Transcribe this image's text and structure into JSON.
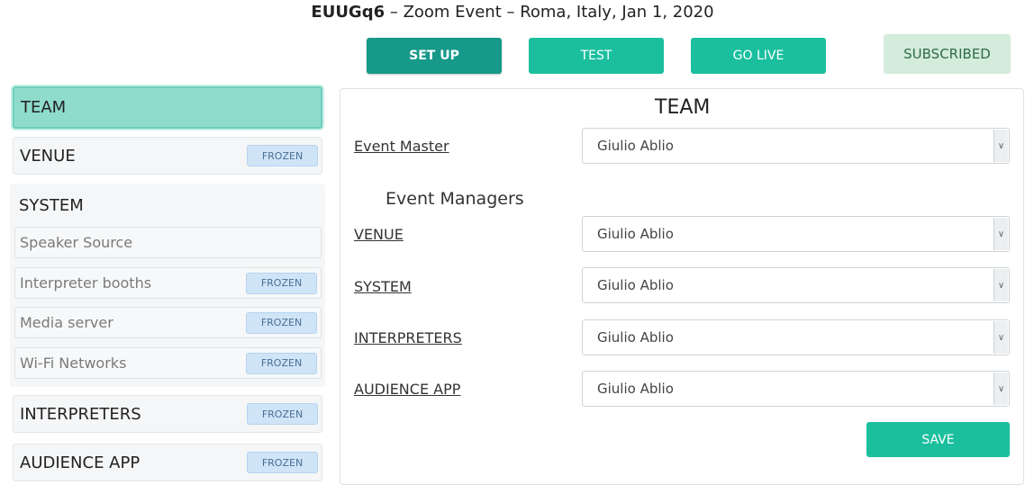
{
  "header": {
    "event_code": "EUUGq6",
    "event_rest": " – Zoom Event – Roma, Italy, Jan 1, 2020"
  },
  "toolbar": {
    "setup_label": "SET UP",
    "test_label": "TEST",
    "golive_label": "GO LIVE",
    "subscribed_label": "SUBSCRIBED"
  },
  "sidebar": {
    "team": "TEAM",
    "venue": "VENUE",
    "system": "SYSTEM",
    "system_items": [
      "Speaker Source",
      "Interpreter booths",
      "Media server",
      "Wi-Fi Networks"
    ],
    "interpreters": "INTERPRETERS",
    "audience_app": "AUDIENCE APP",
    "frozen_badge": "FROZEN"
  },
  "main": {
    "title": "TEAM",
    "event_master_label": "Event Master",
    "event_master_value": "Giulio Ablio",
    "managers_heading": "Event Managers",
    "managers": [
      {
        "label": "VENUE",
        "value": "Giulio Ablio"
      },
      {
        "label": "SYSTEM",
        "value": "Giulio Ablio"
      },
      {
        "label": "INTERPRETERS",
        "value": "Giulio Ablio"
      },
      {
        "label": "AUDIENCE APP",
        "value": "Giulio Ablio"
      }
    ],
    "save_label": "SAVE"
  },
  "colors": {
    "accent": "#1bbf9e",
    "accent_dark": "#17998a",
    "selected": "#8fdccd",
    "subscribed_bg": "#d4ecdb",
    "badge_bg": "#cfe4f7"
  }
}
